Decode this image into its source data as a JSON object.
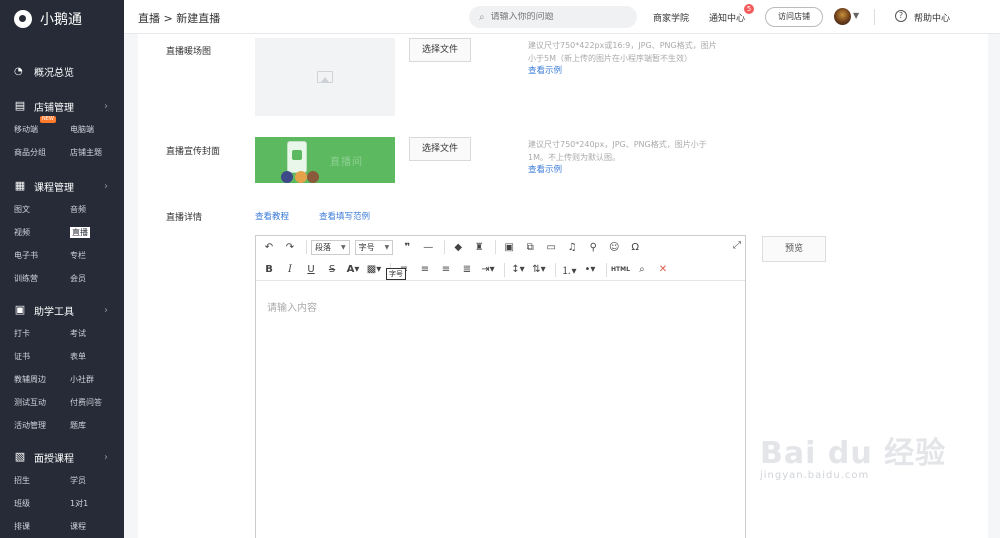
{
  "sidebar": {
    "brand": "小鹅通",
    "overview": "概况总览",
    "groups": [
      {
        "title": "店铺管理",
        "items": [
          "移动端",
          "电脑端",
          "商品分组",
          "店铺主题"
        ]
      },
      {
        "title": "课程管理",
        "items": [
          "图文",
          "音频",
          "视频",
          "直播",
          "电子书",
          "专栏",
          "训练营",
          "会员"
        ]
      },
      {
        "title": "助学工具",
        "items": [
          "打卡",
          "考试",
          "证书",
          "表单",
          "教辅周边",
          "小社群",
          "测试互动",
          "付费问答",
          "活动管理",
          "题库"
        ]
      },
      {
        "title": "面授课程",
        "items": [
          "招生",
          "学员",
          "班级",
          "1对1",
          "排课",
          "课程"
        ]
      }
    ],
    "new_badge": "NEW",
    "active_item": "直播"
  },
  "topbar": {
    "breadcrumb": "直播 > 新建直播",
    "search_placeholder": "请输入你的问题",
    "merchant_academy": "商家学院",
    "notifications": "通知中心",
    "notification_count": "5",
    "visit_store": "访问店铺",
    "help": "帮助中心"
  },
  "form": {
    "warmup_label": "直播暖场图",
    "warmup_button": "选择文件",
    "warmup_hint_1": "建议尺寸750*422px或16:9，JPG、PNG格式，图片",
    "warmup_hint_2": "小于5M（新上传的图片在小程序端暂不生效）",
    "warmup_example": "查看示例",
    "cover_label": "直播宣传封面",
    "cover_button": "选择文件",
    "cover_hint_1": "建议尺寸750*240px，JPG、PNG格式，图片小于",
    "cover_hint_2": "1M。不上传则为默认图。",
    "cover_example": "查看示例",
    "cover_image_text": "直播间",
    "detail_label": "直播详情",
    "tutorial_link": "查看教程",
    "example_link": "查看填写范例"
  },
  "editor": {
    "paragraph_select": "段落",
    "fontsize_select": "字号",
    "tooltip": "字号",
    "placeholder": "请输入内容",
    "preview_button": "预览",
    "html_button": "HTML"
  }
}
